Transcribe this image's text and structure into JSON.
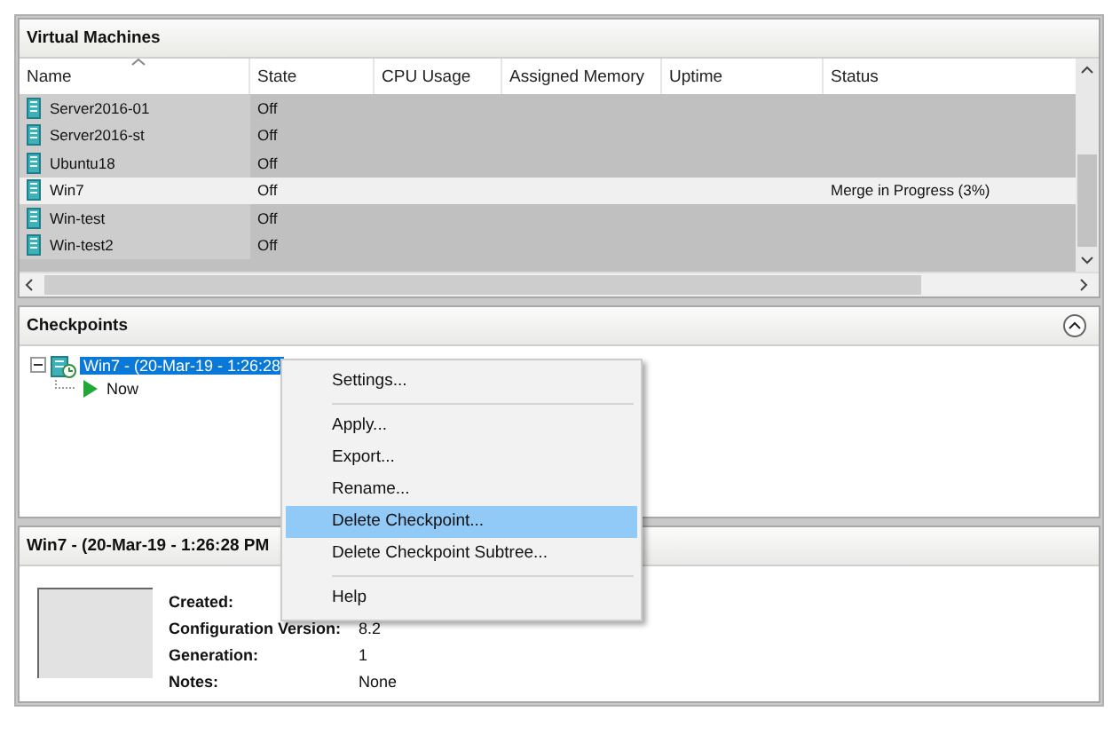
{
  "vm_panel": {
    "title": "Virtual Machines",
    "columns": [
      {
        "label": "Name",
        "sorted": true
      },
      {
        "label": "State",
        "sorted": false
      },
      {
        "label": "CPU Usage",
        "sorted": false
      },
      {
        "label": "Assigned Memory",
        "sorted": false
      },
      {
        "label": "Uptime",
        "sorted": false
      },
      {
        "label": "Status",
        "sorted": false
      }
    ],
    "rows": [
      {
        "cells": [
          "Server2016-01",
          "Off",
          "",
          "",
          "",
          ""
        ],
        "selected": false
      },
      {
        "cells": [
          "Server2016-st",
          "Off",
          "",
          "",
          "",
          ""
        ],
        "selected": false
      },
      {
        "cells": [
          "Ubuntu18",
          "Off",
          "",
          "",
          "",
          ""
        ],
        "selected": false
      },
      {
        "cells": [
          "Win7",
          "Off",
          "",
          "",
          "",
          "Merge in Progress (3%)"
        ],
        "selected": true
      },
      {
        "cells": [
          "Win-test",
          "Off",
          "",
          "",
          "",
          ""
        ],
        "selected": false
      },
      {
        "cells": [
          "Win-test2",
          "Off",
          "",
          "",
          "",
          ""
        ],
        "selected": false
      }
    ]
  },
  "checkpoints_panel": {
    "title": "Checkpoints",
    "collapsed": false,
    "tree": [
      {
        "label": "Win7 - (20-Mar-19 - 1:26:28",
        "kind": "checkpoint",
        "selected": true,
        "expanded": true,
        "children": [
          {
            "label": "Now",
            "kind": "now",
            "selected": false
          }
        ]
      }
    ]
  },
  "context_menu": {
    "items": [
      {
        "kind": "item",
        "label": "Settings...",
        "selected": false
      },
      {
        "kind": "separator"
      },
      {
        "kind": "item",
        "label": "Apply...",
        "selected": false
      },
      {
        "kind": "item",
        "label": "Export...",
        "selected": false
      },
      {
        "kind": "item",
        "label": "Rename...",
        "selected": false
      },
      {
        "kind": "item",
        "label": "Delete Checkpoint...",
        "selected": true
      },
      {
        "kind": "item",
        "label": "Delete Checkpoint Subtree...",
        "selected": false
      },
      {
        "kind": "separator"
      },
      {
        "kind": "item",
        "label": "Help",
        "selected": false
      }
    ]
  },
  "details_panel": {
    "title": "Win7 - (20-Mar-19 - 1:26:28 PM",
    "properties": [
      {
        "label": "Created:"
      },
      {
        "label": "Configuration Version:",
        "value": "8.2"
      },
      {
        "label": "Generation:",
        "value": "1"
      },
      {
        "label": "Notes:",
        "value": "None"
      }
    ]
  }
}
